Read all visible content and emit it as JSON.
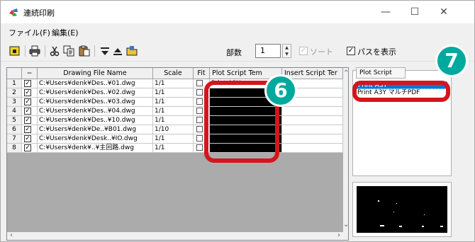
{
  "window": {
    "title": "連続印刷",
    "controls": {
      "minimize": "—",
      "maximize": "☐",
      "close": "✕"
    }
  },
  "menu": [
    {
      "label": "ファイル(F)"
    },
    {
      "label": "編集(E)"
    }
  ],
  "toolbar": {
    "icons": [
      "open-icon",
      "print-icon",
      "cut-icon",
      "copy-icon",
      "paste-icon",
      "move-down-icon",
      "move-up-icon",
      "folder-icon"
    ],
    "copies_label": "部数",
    "copies_value": "1",
    "sort_label": "ソート",
    "sort_checked": true,
    "sort_enabled": false,
    "show_path_label": "パスを表示",
    "show_path_checked": true
  },
  "grid": {
    "columns": [
      "",
      "−",
      "Drawing File Name",
      "Scale",
      "Fit",
      "Plot Script Tem",
      "Insert Script Ter"
    ],
    "rows": [
      {
        "num": "1",
        "checked": true,
        "file": "C:¥Users¥denk¥Des..¥01.dwg",
        "scale": "1/1",
        "fit": false,
        "plot": "Print A3Y",
        "plot_black": false
      },
      {
        "num": "2",
        "checked": true,
        "file": "C:¥Users¥denk¥Des..¥02.dwg",
        "scale": "1/1",
        "fit": false,
        "plot": "",
        "plot_black": true
      },
      {
        "num": "3",
        "checked": true,
        "file": "C:¥Users¥denk¥Des..¥03.dwg",
        "scale": "1/1",
        "fit": false,
        "plot": "",
        "plot_black": true
      },
      {
        "num": "4",
        "checked": true,
        "file": "C:¥Users¥denk¥Des..¥04.dwg",
        "scale": "1/1",
        "fit": false,
        "plot": "",
        "plot_black": true
      },
      {
        "num": "5",
        "checked": true,
        "file": "C:¥Users¥denk¥Des..¥10.dwg",
        "scale": "1/1",
        "fit": false,
        "plot": "",
        "plot_black": true
      },
      {
        "num": "6",
        "checked": true,
        "file": "C:¥Users¥denk¥De..¥B01.dwg",
        "scale": "1/10",
        "fit": false,
        "plot": "",
        "plot_black": true
      },
      {
        "num": "7",
        "checked": true,
        "file": "C:¥Users¥denk¥Desk..¥IO.dwg",
        "scale": "1/1",
        "fit": false,
        "plot": "",
        "plot_black": true
      },
      {
        "num": "8",
        "checked": true,
        "file": "C:¥Users¥denk¥..¥主回路.dwg",
        "scale": "1/1",
        "fit": false,
        "plot": "",
        "plot_black": true
      }
    ]
  },
  "side_panel": {
    "tab_label": "Plot Script",
    "items": [
      {
        "label": "Print A3Y",
        "selected": true
      },
      {
        "label": "Print A3Y マルチPDF",
        "selected": false
      }
    ]
  },
  "callouts": [
    {
      "number": "6"
    },
    {
      "number": "7"
    }
  ],
  "colors": {
    "callout_badge": "#00a99d",
    "highlight_border": "#d4161c",
    "selection": "#0078d7"
  }
}
